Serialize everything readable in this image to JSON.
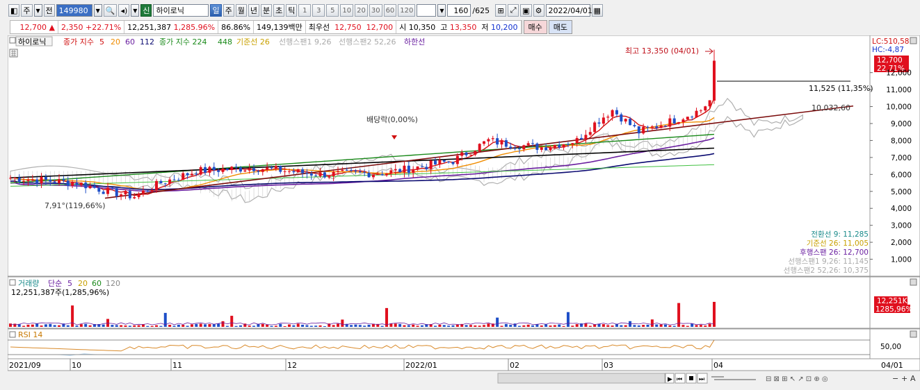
{
  "toolbar1": {
    "period_main": "주",
    "ref_label": "전",
    "stock_code": "149980",
    "new_label": "신",
    "stock_name": "하이로닉",
    "periods": [
      "일",
      "주",
      "월",
      "년",
      "분",
      "초",
      "틱"
    ],
    "numbers": [
      "1",
      "3",
      "5",
      "10",
      "20",
      "30",
      "60",
      "120"
    ],
    "count_display": "160",
    "count_total": "/625",
    "date": "2022/04/01"
  },
  "quote": {
    "price": "12,700",
    "direction": "▲",
    "change": "2,350",
    "change_pct": "+22.71%",
    "volume": "12,251,387",
    "volume_pct": "1,285.96%",
    "ratio": "86.86%",
    "amount": "149,139백만",
    "best_label": "최우선",
    "best_ask": "12,750",
    "best_bid": "12,700",
    "open_label": "시",
    "open": "10,350",
    "high_label": "고",
    "high": "13,350",
    "low_label": "저",
    "low": "10,200",
    "buy_label": "매수",
    "sell_label": "매도"
  },
  "chart_title": "하이로닉",
  "legend": {
    "ma_label": "종가 지수",
    "ma_values": [
      "5",
      "20",
      "60",
      "112"
    ],
    "ma2_label": "종가 지수 224",
    "ma2_val": "448",
    "base_line": "기준선 26",
    "span1": "선행스팬1 9,26",
    "span2": "선행스팬2 52,26",
    "lower_line": "하한선"
  },
  "annotations": {
    "high_note": "최고 13,350 (04/01)",
    "low_note": "7,91°(119,66%)",
    "dividend": "배당락(0,00%)",
    "level1": "11,525 (11,35%)",
    "level2": "10,032,60",
    "lc": "LC:510,58",
    "hc": "HC:-4,87",
    "cur_price": "12,700",
    "cur_pct": "22,71%"
  },
  "y_axis": [
    "12,000",
    "11,000",
    "10,000",
    "9,000",
    "8,000",
    "7,000",
    "6,000",
    "5,000",
    "4,000",
    "3,000",
    "2,000",
    "1,000"
  ],
  "ichimoku_legend": [
    "전환선 9: 11,285",
    "기준선 26: 11,005",
    "후행스팬 26: 12,700",
    "선행스팬1 9,26: 11,145",
    "선행스팬2 52,26: 10,375"
  ],
  "volume_panel": {
    "title": "거래량",
    "ma_label": "단순",
    "ma_values": [
      "5",
      "20",
      "60",
      "120"
    ],
    "info": "12,251,387주(1,285,96%)",
    "badge": "12,251K",
    "badge_pct": "1285,96%"
  },
  "rsi_panel": {
    "title": "RSI 14",
    "level": "50,00"
  },
  "x_axis": [
    "2021/09",
    "10",
    "11",
    "12",
    "2022/01",
    "02",
    "03",
    "04"
  ],
  "x_right": "04/01",
  "colors": {
    "up": "#e0101e",
    "down": "#1e4fc8",
    "ma5": "#d01010",
    "ma20": "#f08c00",
    "ma60": "#6a1fa0",
    "ma112": "#0a0a70",
    "ma224": "#1a8a1a",
    "ma448": "#000000",
    "trend": "#7a0a0a",
    "cloud": "#b0b0b0"
  },
  "chart_data": [
    {
      "type": "candlestick",
      "title": "하이로닉",
      "ylim": [
        0,
        13500
      ],
      "x_labels": [
        "2021/09",
        "10",
        "11",
        "12",
        "2022/01",
        "02",
        "03",
        "04"
      ],
      "key_values": {
        "current": 12700,
        "high": 13350,
        "open": 10350,
        "low": 10200,
        "prev_close": 10350
      },
      "annotated_levels": [
        11525,
        10032.6
      ],
      "ma_series": [
        "종가 지수 5",
        "20",
        "60",
        "112",
        "224",
        "448"
      ]
    },
    {
      "type": "bar",
      "title": "거래량",
      "last_value": 12251387
    },
    {
      "type": "line",
      "title": "RSI 14",
      "reference": 50
    }
  ]
}
